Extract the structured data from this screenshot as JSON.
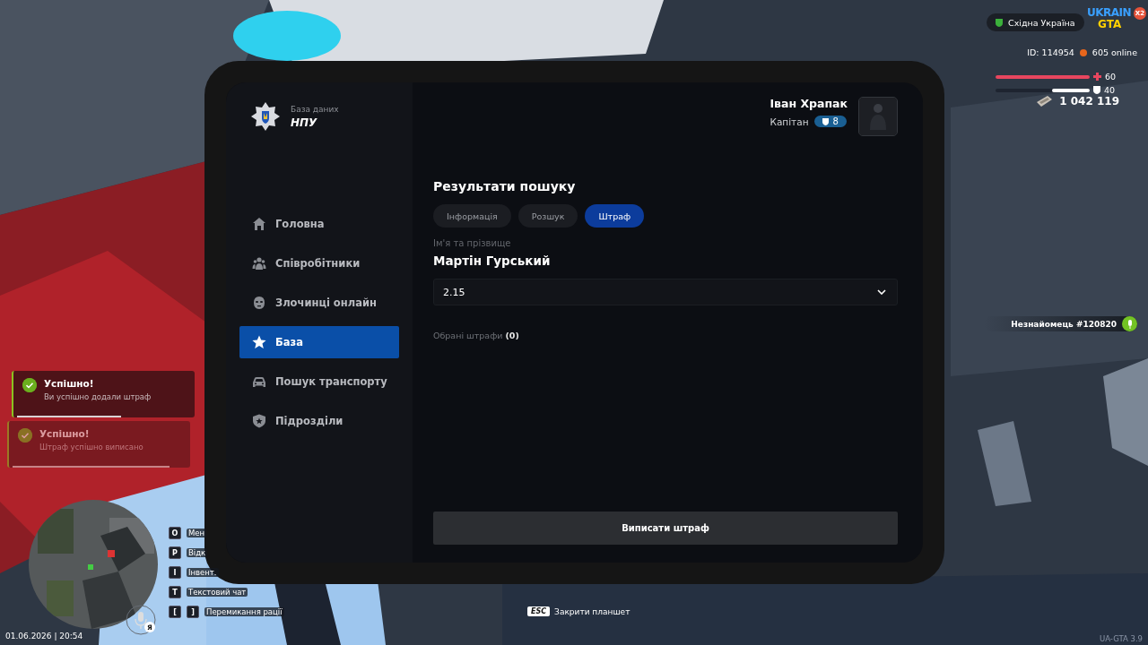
{
  "hud": {
    "region": "Східна Україна",
    "logo": {
      "title": "UKRAIN",
      "subtitle": "GTA",
      "badge": "X2"
    },
    "player_id": "ID: 114954",
    "online": "605 online",
    "health": {
      "level": 1,
      "value": "60"
    },
    "armor": {
      "level": 0.4,
      "value": "40"
    },
    "money": "1 042 119",
    "voice_player": "Незнайомець #120820",
    "datetime": "01.06.2026 | 20:54",
    "mic_badge": "Я",
    "version": "UA-GTA 3.9",
    "close_hint": {
      "key": "ESC",
      "label": "Закрити планшет"
    }
  },
  "notifications": [
    {
      "title": "Успішно!",
      "message": "Ви успішно додали штраф",
      "level": 0.6,
      "dimmed": false
    },
    {
      "title": "Успішно!",
      "message": "Штраф успішно виписано",
      "level": 0.9,
      "dimmed": true
    }
  ],
  "keybinds": [
    {
      "keys": [
        "O"
      ],
      "label": "Мен"
    },
    {
      "keys": [
        "P"
      ],
      "label": "Відк"
    },
    {
      "keys": [
        "I"
      ],
      "label": "Інвент."
    },
    {
      "keys": [
        "T"
      ],
      "label": "Текстовий чат"
    },
    {
      "keys": [
        "[",
        "]"
      ],
      "label": "Перемикання рації"
    }
  ],
  "tablet": {
    "app": {
      "subtitle": "База даних",
      "title": "НПУ"
    },
    "user": {
      "name": "Іван Храпак",
      "rank": "Капітан",
      "level_badge": "8"
    },
    "sidebar": {
      "items": [
        {
          "label": "Головна",
          "selected": false
        },
        {
          "label": "Співробітники",
          "selected": false
        },
        {
          "label": "Злочинці онлайн",
          "selected": false
        },
        {
          "label": "База",
          "selected": true
        },
        {
          "label": "Пошук транспорту",
          "selected": false
        },
        {
          "label": "Підрозділи",
          "selected": false
        }
      ]
    },
    "content": {
      "title": "Результати пошуку",
      "tabs": [
        {
          "label": "Інформація",
          "selected": false
        },
        {
          "label": "Розшук",
          "selected": false
        },
        {
          "label": "Штраф",
          "selected": true
        }
      ],
      "name_label": "Ім'я та прізвище",
      "name": "Мартін Гурський",
      "fine_select": {
        "value": "2.15"
      },
      "selected_fines": "Обрані штрафи **(0)**",
      "submit_button": "Виписати штраф"
    }
  }
}
